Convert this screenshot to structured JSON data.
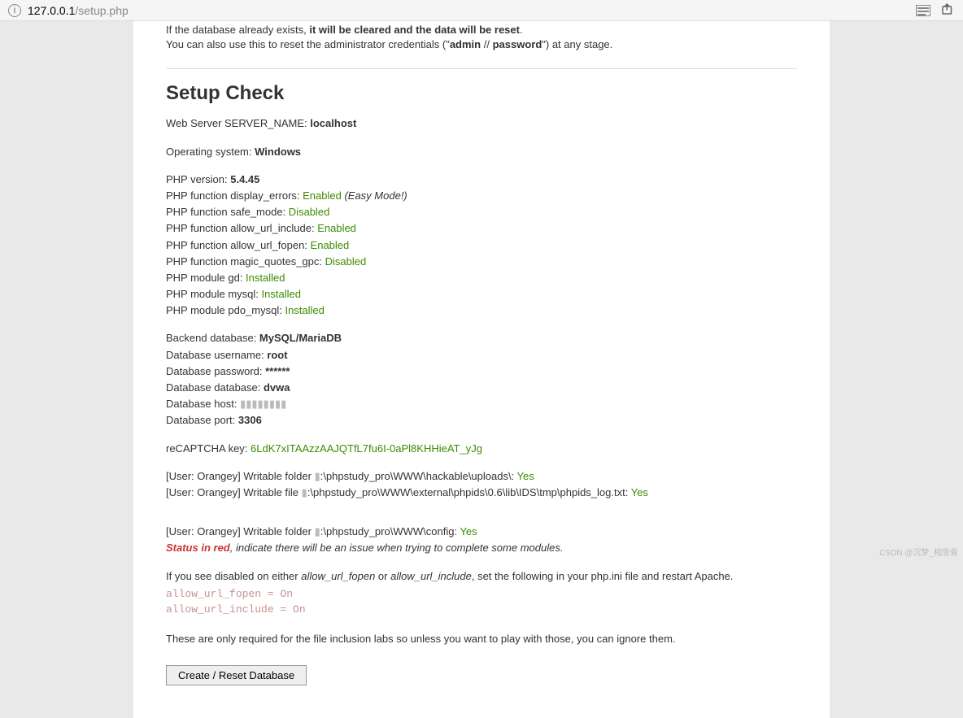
{
  "addrbar": {
    "host": "127.0.0.1",
    "path": "/setup.php"
  },
  "prelude": {
    "line1_pre": "If the database already exists, ",
    "line1_b": "it will be cleared and the data will be reset",
    "line1_post": ".",
    "line2_pre": "You can also use this to reset the administrator credentials (\"",
    "line2_admin": "admin",
    "line2_mid": " // ",
    "line2_pass": "password",
    "line2_post": "\") at any stage."
  },
  "heading": "Setup Check",
  "server": {
    "label": "Web Server SERVER_NAME: ",
    "value": "localhost"
  },
  "os": {
    "label": "Operating system: ",
    "value": "Windows"
  },
  "phpver": {
    "label": "PHP version: ",
    "value": "5.4.45"
  },
  "php_funcs": [
    {
      "label": "PHP function display_errors: ",
      "value": "Enabled",
      "cls": "good",
      "italic": " (Easy Mode!)"
    },
    {
      "label": "PHP function safe_mode: ",
      "value": "Disabled",
      "cls": "good",
      "italic": ""
    },
    {
      "label": "PHP function allow_url_include: ",
      "value": "Enabled",
      "cls": "good",
      "italic": ""
    },
    {
      "label": "PHP function allow_url_fopen: ",
      "value": "Enabled",
      "cls": "good",
      "italic": ""
    },
    {
      "label": "PHP function magic_quotes_gpc: ",
      "value": "Disabled",
      "cls": "good",
      "italic": ""
    },
    {
      "label": "PHP module gd: ",
      "value": "Installed",
      "cls": "good",
      "italic": ""
    },
    {
      "label": "PHP module mysql: ",
      "value": "Installed",
      "cls": "good",
      "italic": ""
    },
    {
      "label": "PHP module pdo_mysql: ",
      "value": "Installed",
      "cls": "good",
      "italic": ""
    }
  ],
  "db": [
    {
      "label": "Backend database: ",
      "value": "MySQL/MariaDB",
      "b": true
    },
    {
      "label": "Database username: ",
      "value": "root",
      "b": true
    },
    {
      "label": "Database password: ",
      "value": "******",
      "b": true
    },
    {
      "label": "Database database: ",
      "value": "dvwa",
      "b": true
    },
    {
      "label": "Database host: ",
      "value": "▮▮▮▮▮▮▮▮",
      "pix": true
    },
    {
      "label": "Database port: ",
      "value": "3306",
      "b": true
    }
  ],
  "recaptcha": {
    "label": "reCAPTCHA key: ",
    "value": "6LdK7xITAAzzAAJQTfL7fu6I-0aPl8KHHieAT_yJg"
  },
  "writable": {
    "line1_pre": "[User: Orangey] Writable folder ",
    "line1_pix": "▮",
    "line1_mid": ":\\phpstudy_pro\\WWW\\hackable\\uploads\\: ",
    "line1_val": "Yes",
    "line2_pre": "[User: Orangey] Writable file ",
    "line2_pix": "▮",
    "line2_mid": ":\\phpstudy_pro\\WWW\\external\\phpids\\0.6\\lib\\IDS\\tmp\\phpids_log.txt: ",
    "line2_val": "Yes",
    "line3_pre": "[User: Orangey] Writable folder ",
    "line3_pix": "▮",
    "line3_mid": ":\\phpstudy_pro\\WWW\\config: ",
    "line3_val": "Yes"
  },
  "redline": {
    "pre": "Status in red",
    "post": ", indicate there will be an issue when trying to complete some modules."
  },
  "advice": {
    "pre": "If you see disabled on either ",
    "i1": "allow_url_fopen",
    "mid": " or ",
    "i2": "allow_url_include",
    "post": ", set the following in your php.ini file and restart Apache."
  },
  "mono": [
    "allow_url_fopen = On",
    "allow_url_include = On"
  ],
  "closing": "These are only required for the file inclusion labs so unless you want to play with those, you can ignore them.",
  "button_label": "Create / Reset Database",
  "watermark": "CSDN @沉梦_相思骨"
}
